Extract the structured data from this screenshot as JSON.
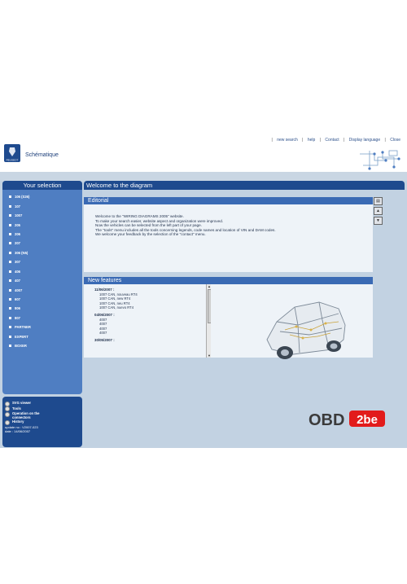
{
  "header": {
    "links": [
      "new search",
      "help",
      "Contact",
      "Display language",
      "Close"
    ],
    "app_title": "Schématique",
    "logo_text": "PEUGEOT"
  },
  "sidebar": {
    "title": "Your selection",
    "items": [
      "106 (S26)",
      "107",
      "1007",
      "205",
      "206",
      "207",
      "306 (N5)",
      "307",
      "406",
      "407",
      "4007",
      "607",
      "806",
      "807",
      "PARTNER",
      "EXPERT",
      "BOXER"
    ],
    "options": [
      "SVG viewer",
      "Tools",
      "Operation on the connectors",
      "History"
    ],
    "update": "update no : V2007-023",
    "date": "date : 14/06/2007"
  },
  "content": {
    "title": "Welcome to the diagram",
    "editorial_title": "Editorial",
    "editorial_lines": [
      "Welcome to the \"WIRING DIAGRAMS 2005\" website.",
      "To make your search easier, website aspect and organization were improved.",
      "Now the vehicles can be selected from the left part of your page.",
      "The \"tools\" menu includes all the tools concerning legends, code names and location of VIN and DAM codes.",
      "We welcome your feedback by the selection of the \"contact\" menu."
    ],
    "new_features_title": "New features",
    "features": [
      {
        "date": "11/06/2007 :",
        "lines": [
          "1007 CAN, nouveau RT4",
          "1007 CAN, new RT4",
          "1007 CAN, neu RT4",
          "1007 CAN, nuevo RT4"
        ]
      },
      {
        "date": "04/06/2007 :",
        "lines": [
          "4007",
          "4007",
          "4007",
          "4007"
        ]
      },
      {
        "date": "30/05/2007 :",
        "lines": []
      }
    ],
    "watermark": "OBD2be",
    "watermark_part1": "OBD",
    "watermark_part2": "2be"
  },
  "colors": {
    "accent": "#1e4a8e",
    "sidebar": "#4f7ec2",
    "background": "#c2d2e2"
  }
}
